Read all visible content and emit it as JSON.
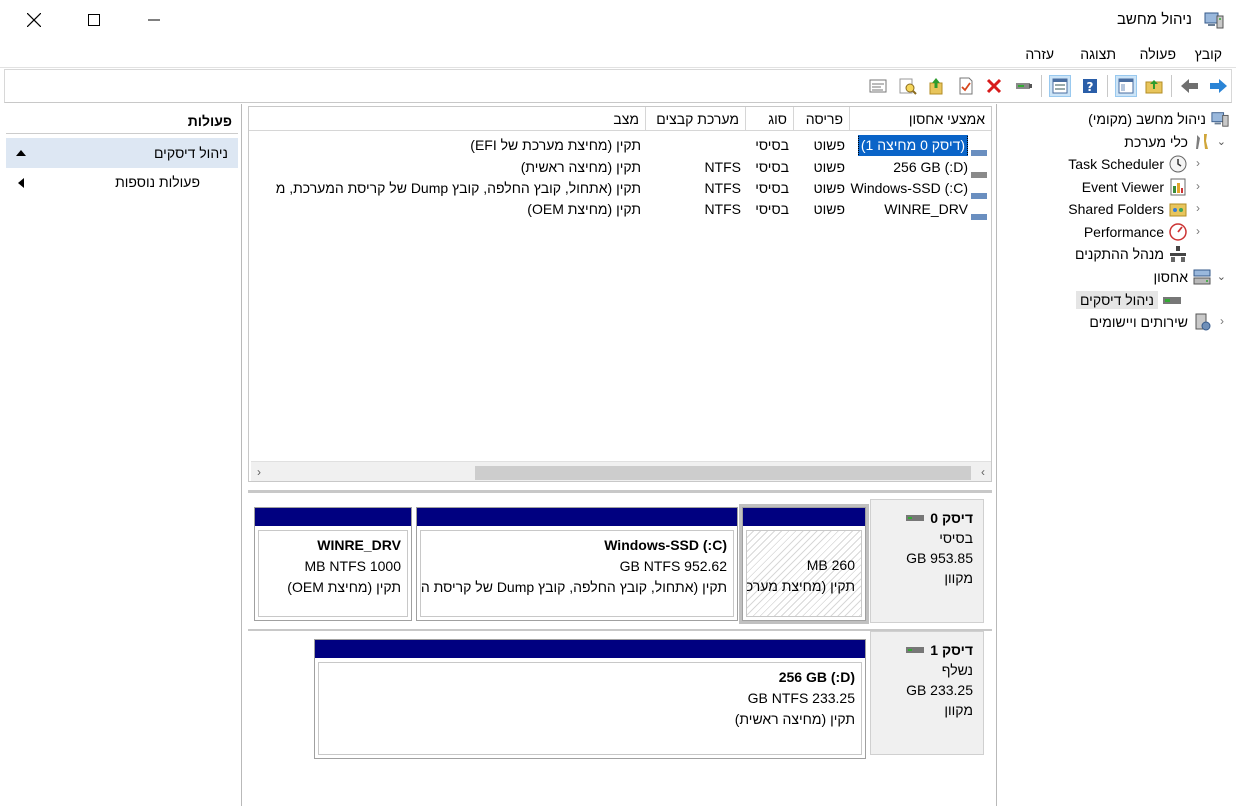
{
  "window": {
    "title": "ניהול מחשב"
  },
  "menu": [
    "קובץ",
    "פעולה",
    "תצוגה",
    "עזרה"
  ],
  "tree": {
    "root": "ניהול מחשב (מקומי)",
    "system_tools": "כלי מערכת",
    "task_scheduler": "Task Scheduler",
    "event_viewer": "Event Viewer",
    "shared_folders": "Shared Folders",
    "performance": "Performance",
    "device_manager": "מנהל ההתקנים",
    "storage": "אחסון",
    "disk_management": "ניהול דיסקים",
    "services": "שירותים ויישומים"
  },
  "actions": {
    "header": "פעולות",
    "selected": "ניהול דיסקים",
    "more": "פעולות נוספות"
  },
  "volumes": {
    "columns": {
      "volume": "אמצעי אחסון",
      "layout": "פריסה",
      "type": "סוג",
      "filesystem": "מערכת קבצים",
      "status": "מצב"
    },
    "rows": [
      {
        "volume": "(דיסק 0 מחיצה 1)",
        "layout": "פשוט",
        "type": "בסיסי",
        "filesystem": "",
        "status": "תקין (מחיצת מערכת של EFI)"
      },
      {
        "volume": "(D:) 256 GB",
        "layout": "פשוט",
        "type": "בסיסי",
        "filesystem": "NTFS",
        "status": "תקין (מחיצה ראשית)"
      },
      {
        "volume": "(C:) Windows-SSD",
        "layout": "פשוט",
        "type": "בסיסי",
        "filesystem": "NTFS",
        "status": "תקין (אתחול, קובץ החלפה, קובץ Dump של קריסת המערכת, מ"
      },
      {
        "volume": "WINRE_DRV",
        "layout": "פשוט",
        "type": "בסיסי",
        "filesystem": "NTFS",
        "status": "תקין (מחיצת OEM)"
      }
    ]
  },
  "disks": {
    "disk0": {
      "name": "דיסק 0",
      "type": "בסיסי",
      "size": "GB 953.85",
      "status": "מקוון",
      "partitions": {
        "efi": {
          "size": "MB 260",
          "status": "תקין (מחיצת מערכת"
        },
        "c": {
          "name": "(C:)  Windows-SSD",
          "size": "GB NTFS 952.62",
          "status": "תקין (אתחול, קובץ החלפה, קובץ Dump של קריסת המערכת"
        },
        "winre": {
          "name": "WINRE_DRV",
          "size": "MB NTFS 1000",
          "status": "תקין (מחיצת OEM)"
        }
      }
    },
    "disk1": {
      "name": "דיסק 1",
      "type": "נשלף",
      "size": "GB 233.25",
      "status": "מקוון",
      "partitions": {
        "d": {
          "name": "(D:)  256 GB",
          "size": "GB NTFS 233.25",
          "status": "תקין (מחיצה ראשית)"
        }
      }
    }
  },
  "colors": {
    "partition_bar": "#000080",
    "selection": "#0a64c8",
    "actions_selected": "#dde7f3"
  },
  "icons": {
    "toolbar": [
      "forward-arrow-icon",
      "back-arrow-icon",
      "folder-up-icon",
      "show-hide-tree-icon",
      "help-icon",
      "properties-icon",
      "connect-icon",
      "delete-icon",
      "check-icon",
      "import-icon",
      "search-icon",
      "list-view-icon"
    ]
  }
}
